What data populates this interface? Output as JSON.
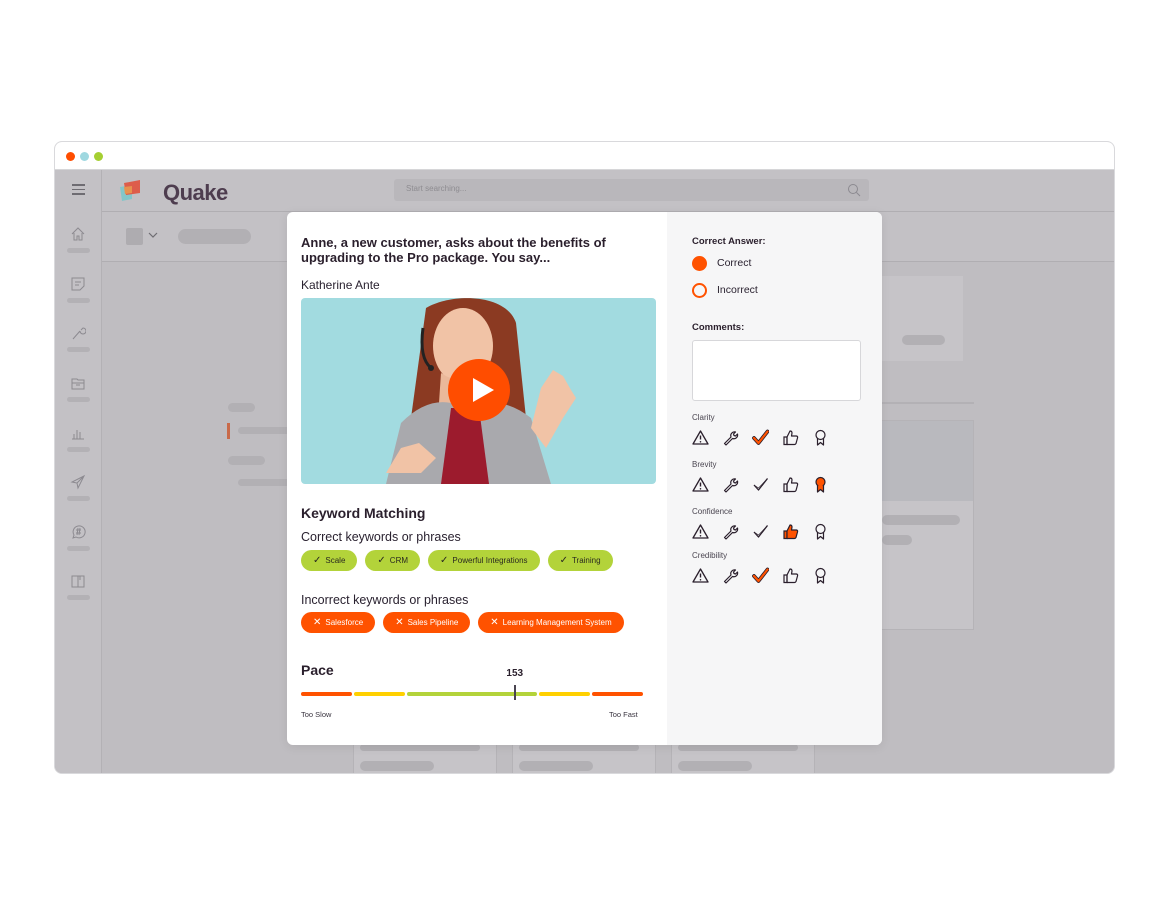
{
  "window": {
    "traffic_lights": [
      {
        "name": "close",
        "color": "#ff4d00"
      },
      {
        "name": "minimize",
        "color": "#9fd8e0"
      },
      {
        "name": "maximize",
        "color": "#a5cf32"
      }
    ]
  },
  "app": {
    "logo_text": "Quake",
    "search": {
      "placeholder": "Start searching..."
    },
    "sidebar": {
      "items": [
        {
          "icon": "home-icon"
        },
        {
          "icon": "note-icon"
        },
        {
          "icon": "wrench-icon"
        },
        {
          "icon": "folder-icon"
        },
        {
          "icon": "bar-chart-icon"
        },
        {
          "icon": "send-icon"
        },
        {
          "icon": "hashtag-chat-icon"
        },
        {
          "icon": "book-icon"
        }
      ]
    }
  },
  "modal": {
    "question": "Anne, a new customer, asks about the benefits of upgrading to the Pro package. You say...",
    "candidate_name": "Katherine Ante",
    "video": {
      "play_icon": "play-icon"
    },
    "keyword_matching": {
      "title": "Keyword Matching",
      "correct_label": "Correct keywords or phrases",
      "correct": [
        "Scale",
        "CRM",
        "Powerful Integrations",
        "Training"
      ],
      "incorrect_label": "Incorrect keywords or phrases",
      "incorrect": [
        "Salesforce",
        "Sales Pipeline",
        "Learning Management System"
      ]
    },
    "pace": {
      "title": "Pace",
      "value": "153",
      "marker_fraction": 0.625,
      "segments": [
        {
          "color": "#ff5200",
          "weight": 1
        },
        {
          "color": "#ffd000",
          "weight": 1
        },
        {
          "color": "#b3d33a",
          "weight": 2.55
        },
        {
          "color": "#ffd000",
          "weight": 1
        },
        {
          "color": "#ff5200",
          "weight": 1
        }
      ],
      "min_label": "Too Slow",
      "max_label": "Too Fast"
    },
    "grading": {
      "correct_answer_title": "Correct Answer:",
      "options": [
        {
          "label": "Correct",
          "selected": true
        },
        {
          "label": "Incorrect",
          "selected": false
        }
      ],
      "comments_title": "Comments:",
      "comments_value": "",
      "categories": [
        {
          "label": "Clarity",
          "selected": "check"
        },
        {
          "label": "Brevity",
          "selected": "award"
        },
        {
          "label": "Confidence",
          "selected": "thumbs-up"
        },
        {
          "label": "Credibility",
          "selected": "check"
        }
      ],
      "rating_icons": [
        "warning",
        "wrench",
        "check",
        "thumbs-up",
        "award"
      ],
      "accent_color": "#ff5200"
    }
  }
}
